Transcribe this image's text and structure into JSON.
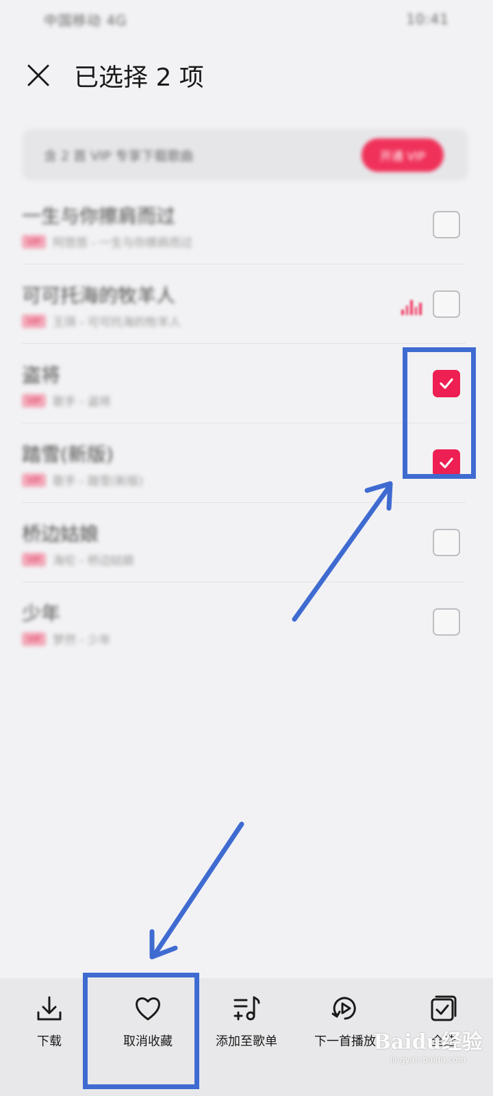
{
  "status_bar": {
    "left": "中国移动 4G",
    "right": "10:41"
  },
  "header": {
    "title": "已选择 2 项"
  },
  "vip_banner": {
    "text": "含 2 首 VIP 专享下载歌曲",
    "button": "开通 VIP"
  },
  "songs": [
    {
      "title": "一生与你擦肩而过",
      "tag": "VIP",
      "subtitle": "阿悠悠 - 一生与你擦肩而过",
      "checked": false,
      "playing": false
    },
    {
      "title": "可可托海的牧羊人",
      "tag": "VIP",
      "subtitle": "王琪 - 可可托海的牧羊人",
      "checked": false,
      "playing": true
    },
    {
      "title": "盗将",
      "tag": "VIP",
      "subtitle": "歌手 - 盗将",
      "checked": true,
      "playing": false
    },
    {
      "title": "踏雪(新版)",
      "tag": "VIP",
      "subtitle": "歌手 - 踏雪(新版)",
      "checked": true,
      "playing": false
    },
    {
      "title": "桥边姑娘",
      "tag": "VIP",
      "subtitle": "海伦 - 桥边姑娘",
      "checked": false,
      "playing": false
    },
    {
      "title": "少年",
      "tag": "VIP",
      "subtitle": "梦然 - 少年",
      "checked": false,
      "playing": false
    }
  ],
  "bottom_bar": {
    "actions": [
      {
        "label": "下载",
        "icon": "download-icon"
      },
      {
        "label": "取消收藏",
        "icon": "heart-icon"
      },
      {
        "label": "添加至歌单",
        "icon": "add-to-playlist-icon"
      },
      {
        "label": "下一首播放",
        "icon": "play-next-icon"
      },
      {
        "label": "全选",
        "icon": "select-all-icon"
      }
    ]
  },
  "watermark": {
    "logo": "Baidu经验",
    "sub": "jingyan.baidu.com"
  },
  "colors": {
    "accent": "#ee1f52",
    "annotation": "#3f6bd1"
  }
}
